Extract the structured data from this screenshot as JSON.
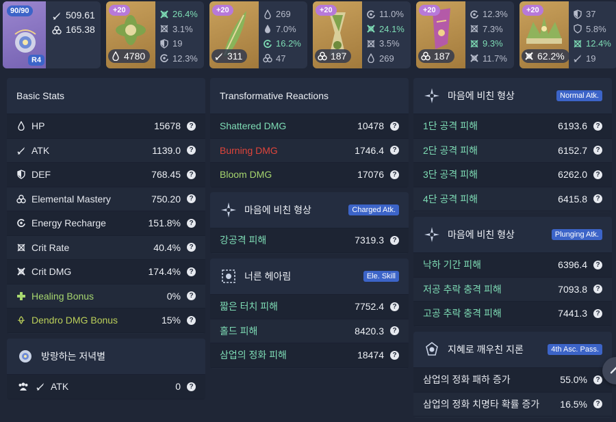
{
  "weapon": {
    "level": "90/90",
    "refinement": "R4",
    "atk": "509.61",
    "em": "165.38"
  },
  "artifacts": [
    {
      "level": "+20",
      "main_value": "4780",
      "main_icon": "hp-drop-icon",
      "subs": [
        {
          "icon": "crit-dmg-icon",
          "value": "26.4%",
          "hl": true
        },
        {
          "icon": "crit-rate-icon",
          "value": "3.1%",
          "hl": false
        },
        {
          "icon": "def-icon",
          "value": "19",
          "hl": false
        },
        {
          "icon": "energy-recharge-icon",
          "value": "12.3%",
          "hl": false
        }
      ]
    },
    {
      "level": "+20",
      "main_value": "311",
      "main_icon": "atk-sword-icon",
      "subs": [
        {
          "icon": "hp-drop-icon",
          "value": "269",
          "hl": false
        },
        {
          "icon": "hp-drop-icon",
          "value": "7.0%",
          "hl": false
        },
        {
          "icon": "energy-recharge-icon",
          "value": "16.2%",
          "hl": true
        },
        {
          "icon": "elemental-mastery-icon",
          "value": "47",
          "hl": false
        }
      ]
    },
    {
      "level": "+20",
      "main_value": "187",
      "main_icon": "elemental-mastery-icon",
      "subs": [
        {
          "icon": "energy-recharge-icon",
          "value": "11.0%",
          "hl": false
        },
        {
          "icon": "crit-dmg-icon",
          "value": "24.1%",
          "hl": true
        },
        {
          "icon": "crit-rate-icon",
          "value": "3.5%",
          "hl": false
        },
        {
          "icon": "hp-drop-icon",
          "value": "269",
          "hl": false
        }
      ]
    },
    {
      "level": "+20",
      "main_value": "187",
      "main_icon": "elemental-mastery-icon",
      "subs": [
        {
          "icon": "energy-recharge-icon",
          "value": "12.3%",
          "hl": false
        },
        {
          "icon": "crit-rate-icon",
          "value": "7.3%",
          "hl": false
        },
        {
          "icon": "crit-rate-icon",
          "value": "9.3%",
          "hl": true
        },
        {
          "icon": "crit-dmg-icon",
          "value": "11.7%",
          "hl": false
        }
      ]
    },
    {
      "level": "+20",
      "main_value": "62.2%",
      "main_icon": "crit-dmg-icon",
      "subs": [
        {
          "icon": "def-icon",
          "value": "37",
          "hl": false
        },
        {
          "icon": "def-icon",
          "value": "5.8%",
          "hl": false
        },
        {
          "icon": "crit-rate-icon",
          "value": "12.4%",
          "hl": true
        },
        {
          "icon": "atk-sword-icon",
          "value": "19",
          "hl": false
        }
      ]
    }
  ],
  "basic_stats": {
    "title": "Basic Stats",
    "rows": [
      {
        "label": "HP",
        "value": "15678",
        "icon": "hp-drop-icon",
        "color": ""
      },
      {
        "label": "ATK",
        "value": "1139.0",
        "icon": "atk-sword-icon",
        "color": ""
      },
      {
        "label": "DEF",
        "value": "768.45",
        "icon": "def-icon",
        "color": ""
      },
      {
        "label": "Elemental Mastery",
        "value": "750.20",
        "icon": "elemental-mastery-icon",
        "color": ""
      },
      {
        "label": "Energy Recharge",
        "value": "151.8%",
        "icon": "energy-recharge-icon",
        "color": ""
      },
      {
        "label": "Crit Rate",
        "value": "40.4%",
        "icon": "crit-rate-icon",
        "color": ""
      },
      {
        "label": "Crit DMG",
        "value": "174.4%",
        "icon": "crit-dmg-icon",
        "color": ""
      },
      {
        "label": "Healing Bonus",
        "value": "0%",
        "icon": "healing-cross-icon",
        "color": "green"
      },
      {
        "label": "Dendro DMG Bonus",
        "value": "15%",
        "icon": "dendro-icon",
        "color": "lime"
      }
    ]
  },
  "buff_panel": {
    "title": "방랑하는 저녁별",
    "row_label": "ATK",
    "row_value": "0"
  },
  "transformative": {
    "title": "Transformative Reactions",
    "rows": [
      {
        "label": "Shattered DMG",
        "value": "10478",
        "color": "teal"
      },
      {
        "label": "Burning DMG",
        "value": "1746.4",
        "color": "red"
      },
      {
        "label": "Bloom DMG",
        "value": "17076",
        "color": "green"
      }
    ]
  },
  "charged": {
    "title": "마음에 비친 형상",
    "tag": "Charged Atk.",
    "rows": [
      {
        "label": "강공격 피해",
        "value": "7319.3"
      }
    ]
  },
  "skill": {
    "title": "너른 헤아림",
    "tag": "Ele. Skill",
    "rows": [
      {
        "label": "짧은 터치 피해",
        "value": "7752.4"
      },
      {
        "label": "홀드 피해",
        "value": "8420.3"
      },
      {
        "label": "삼업의 정화 피해",
        "value": "18474"
      }
    ]
  },
  "normal": {
    "title": "마음에 비친 형상",
    "tag": "Normal Atk.",
    "rows": [
      {
        "label": "1단 공격 피해",
        "value": "6193.6"
      },
      {
        "label": "2단 공격 피해",
        "value": "6152.7"
      },
      {
        "label": "3단 공격 피해",
        "value": "6262.0"
      },
      {
        "label": "4단 공격 피해",
        "value": "6415.8"
      }
    ]
  },
  "plunging": {
    "title": "마음에 비친 형상",
    "tag": "Plunging Atk.",
    "rows": [
      {
        "label": "낙하 기간 피해",
        "value": "6396.4"
      },
      {
        "label": "저공 추락 충격 피해",
        "value": "7093.8"
      },
      {
        "label": "고공 추락 충격 피해",
        "value": "7441.3"
      }
    ]
  },
  "passive": {
    "title": "지혜로 깨우친 지론",
    "tag": "4th Asc. Pass.",
    "rows": [
      {
        "label": "삼업의 정화 패하 증가",
        "value": "55.0%"
      },
      {
        "label": "삼업의 정화 치명타 확률 증가",
        "value": "16.5%"
      }
    ]
  },
  "help_symbol": "?"
}
